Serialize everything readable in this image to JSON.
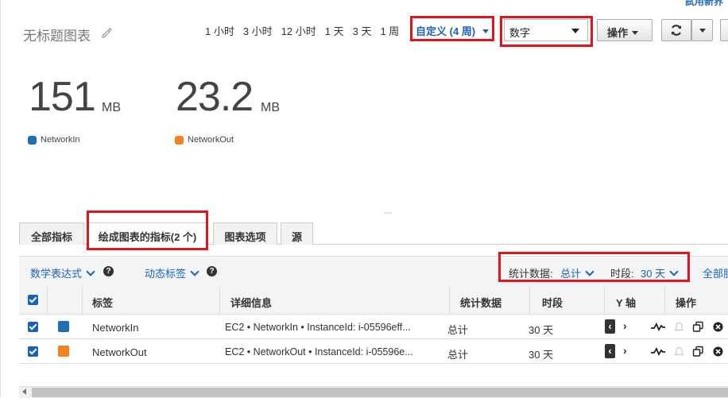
{
  "header": {
    "top_link": "試用新界",
    "title": "无标题图表",
    "time_ranges": [
      "1 小时",
      "3 小时",
      "12 小时",
      "1 天",
      "3 天",
      "1 周"
    ],
    "custom_range": "自定义 (4 周)",
    "view_select": "数字",
    "actions_label": "操作"
  },
  "metrics": [
    {
      "value": "151",
      "unit": "MB",
      "legend": "NetworkIn",
      "color": "#1f6fb5"
    },
    {
      "value": "23.2",
      "unit": "MB",
      "legend": "NetworkOut",
      "color": "#f58220"
    }
  ],
  "divider": "---",
  "tabs": [
    {
      "label": "全部指标"
    },
    {
      "label": "绘成图表的指标(2 个)"
    },
    {
      "label": "图表选项"
    },
    {
      "label": "源"
    }
  ],
  "toolbar": {
    "math_expr": "数学表达式",
    "dynamic_labels": "动态标签",
    "stat_label": "统计数据:",
    "stat_value": "总计",
    "period_label": "时段:",
    "period_value": "30 天",
    "all_link": "全部服"
  },
  "table": {
    "headers": [
      "标签",
      "详细信息",
      "统计数据",
      "时段",
      "Y 轴",
      "操作"
    ],
    "rows": [
      {
        "label": "NetworkIn",
        "details": "EC2 • NetworkIn • InstanceId: i-05596eff...",
        "stat": "总计",
        "period": "30 天",
        "color": "#1f6fb5"
      },
      {
        "label": "NetworkOut",
        "details": "EC2 • NetworkOut • InstanceId: i-05596e...",
        "stat": "总计",
        "period": "30 天",
        "color": "#f58220"
      }
    ]
  }
}
